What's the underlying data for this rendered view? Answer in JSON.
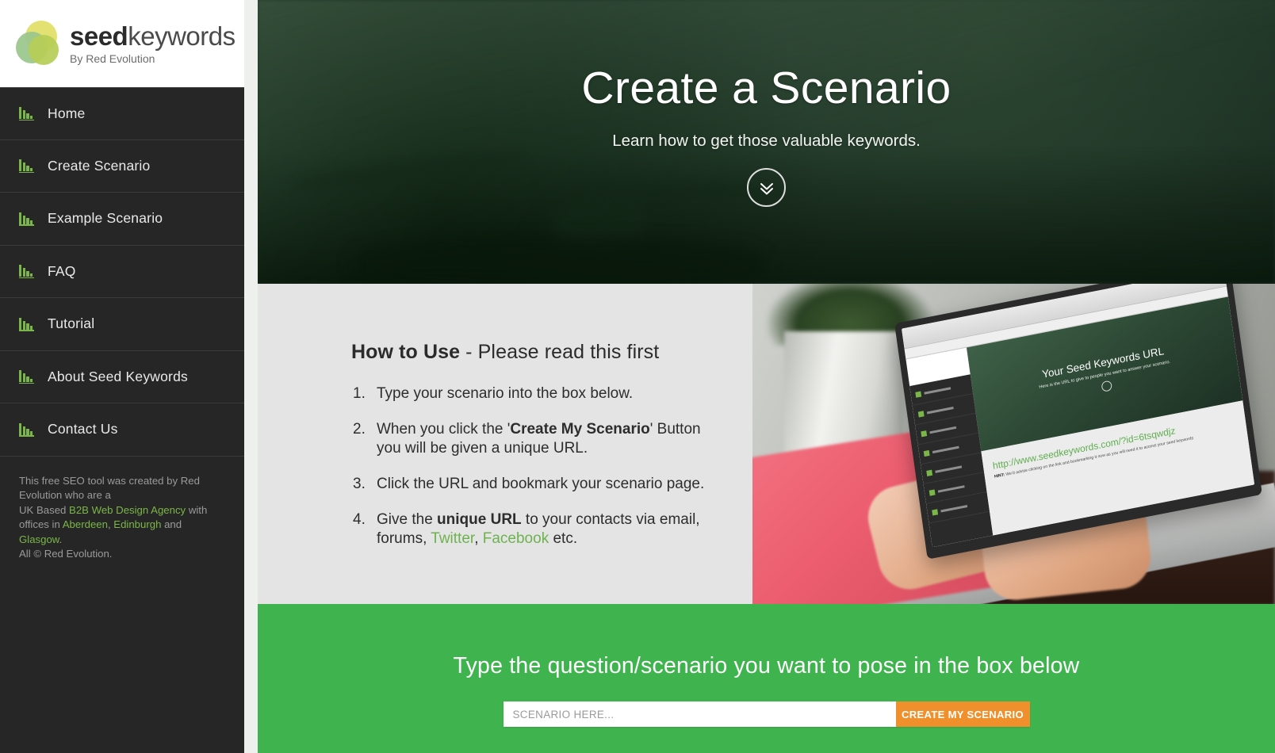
{
  "brand": {
    "word_bold": "seed",
    "word_light": "keywords",
    "tagline": "By Red Evolution"
  },
  "sidebar": {
    "items": [
      {
        "label": "Home",
        "icon": "bar-chart-icon"
      },
      {
        "label": "Create Scenario",
        "icon": "bar-chart-icon"
      },
      {
        "label": "Example Scenario",
        "icon": "bar-chart-icon"
      },
      {
        "label": "FAQ",
        "icon": "bar-chart-icon"
      },
      {
        "label": "Tutorial",
        "icon": "bar-chart-icon"
      },
      {
        "label": "About Seed Keywords",
        "icon": "bar-chart-icon"
      },
      {
        "label": "Contact Us",
        "icon": "bar-chart-icon"
      }
    ],
    "footer": {
      "line1": "This free SEO tool was created by Red",
      "line2": "Evolution who are a",
      "line3_pre": "UK Based ",
      "line3_link": "B2B Web Design Agency",
      "line3_post": " with",
      "line4_pre": "offices in ",
      "link_aberdeen": "Aberdeen",
      "sep1": ", ",
      "link_edinburgh": "Edinburgh",
      "sep2": " and ",
      "link_glasgow": "Glasgow",
      "sep3": ".",
      "line5": "All © Red Evolution."
    }
  },
  "hero": {
    "title": "Create a Scenario",
    "subtitle": "Learn how to get those valuable keywords.",
    "scroll_icon": "chevron-double-down-icon"
  },
  "howto": {
    "heading_bold": "How to Use",
    "heading_rest": " - Please read this first",
    "steps": [
      {
        "text": "Type your scenario into the box below."
      },
      {
        "pre": "When you click the '",
        "bold": "Create My Scenario",
        "post": "' Button you will be given a unique URL."
      },
      {
        "text": "Click the URL and bookmark your scenario page."
      },
      {
        "pre": "Give the ",
        "bold": "unique URL",
        "post": " to your contacts via email, forums, ",
        "link1": "Twitter",
        "mid": ", ",
        "link2": "Facebook",
        "tail": " etc."
      }
    ]
  },
  "photo": {
    "alt": "hands typing on a laptop showing the seed keywords URL page",
    "laptop": {
      "hero_title": "Your Seed Keywords URL",
      "hero_sub": "Here is the URL to give to people you want to answer your scenario.",
      "url": "http://www.seedkeywords.com/?id=6tsqwdjz",
      "hint_label": "HINT:",
      "hint_text": " We'd advise clicking on the link and bookmarking it now as you will need it to access your seed keywords"
    }
  },
  "cta": {
    "title": "Type the question/scenario you want to pose in the box below",
    "input_placeholder": "SCENARIO HERE...",
    "input_value": "",
    "button_label": "CREATE MY SCENARIO"
  },
  "colors": {
    "sidebar_bg": "#262626",
    "accent_green": "#7ab648",
    "cta_green": "#3fb44e",
    "cta_button_orange": "#f0902c",
    "hero_green": "#22382a",
    "panel_gray": "#e4e4e4"
  }
}
